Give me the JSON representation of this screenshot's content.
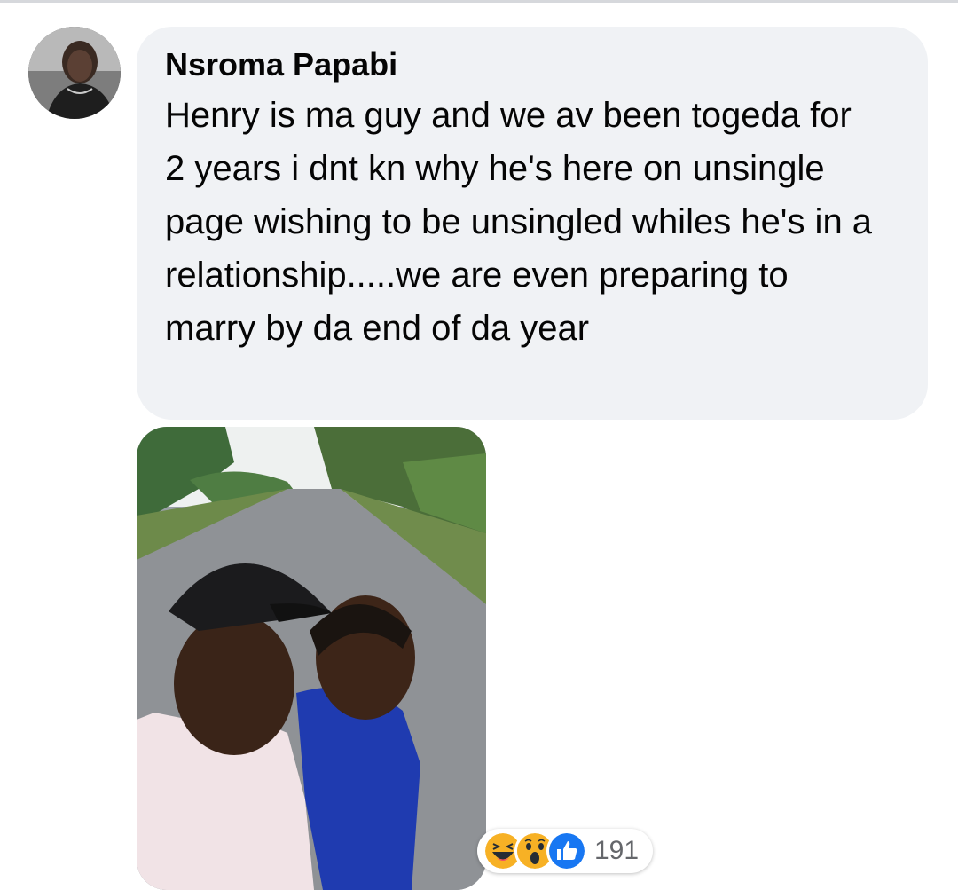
{
  "comment": {
    "author": "Nsroma Papabi",
    "text": "Henry is ma guy and we av been togeda for 2 years i dnt kn why he's here on unsingle page wishing to be unsingled whiles he's in a relationship.....we are even preparing to marry by da end of da year"
  },
  "reactions": {
    "icons": [
      "haha-icon",
      "wow-icon",
      "like-icon"
    ],
    "count": "191"
  },
  "colors": {
    "bubble": "#f0f2f5",
    "like_blue": "#1877f2",
    "emoji_yellow": "#f7b125",
    "count_gray": "#65676b"
  }
}
